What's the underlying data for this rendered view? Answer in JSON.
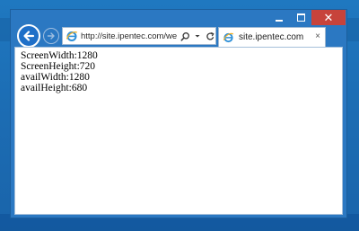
{
  "window": {
    "caption_minimize": "–",
    "caption_maximize": "□",
    "caption_close": "✕"
  },
  "toolbar": {
    "back_icon": "back-arrow-icon",
    "forward_icon": "forward-arrow-icon",
    "address": "http://site.ipentec.com/we",
    "search_icon": "search-icon",
    "dropdown_icon": "dropdown-arrow-icon",
    "refresh_icon": "refresh-icon"
  },
  "tab": {
    "title": "site.ipentec.com",
    "close": "×"
  },
  "content": {
    "lines": [
      "ScreenWidth:1280",
      "ScreenHeight:720",
      "availWidth:1280",
      "availHeight:680"
    ]
  },
  "colors": {
    "desktop": "#1c6db4",
    "window_frame": "#2b78c2",
    "close_button": "#c7433b",
    "back_button": "#1e6fc8"
  }
}
